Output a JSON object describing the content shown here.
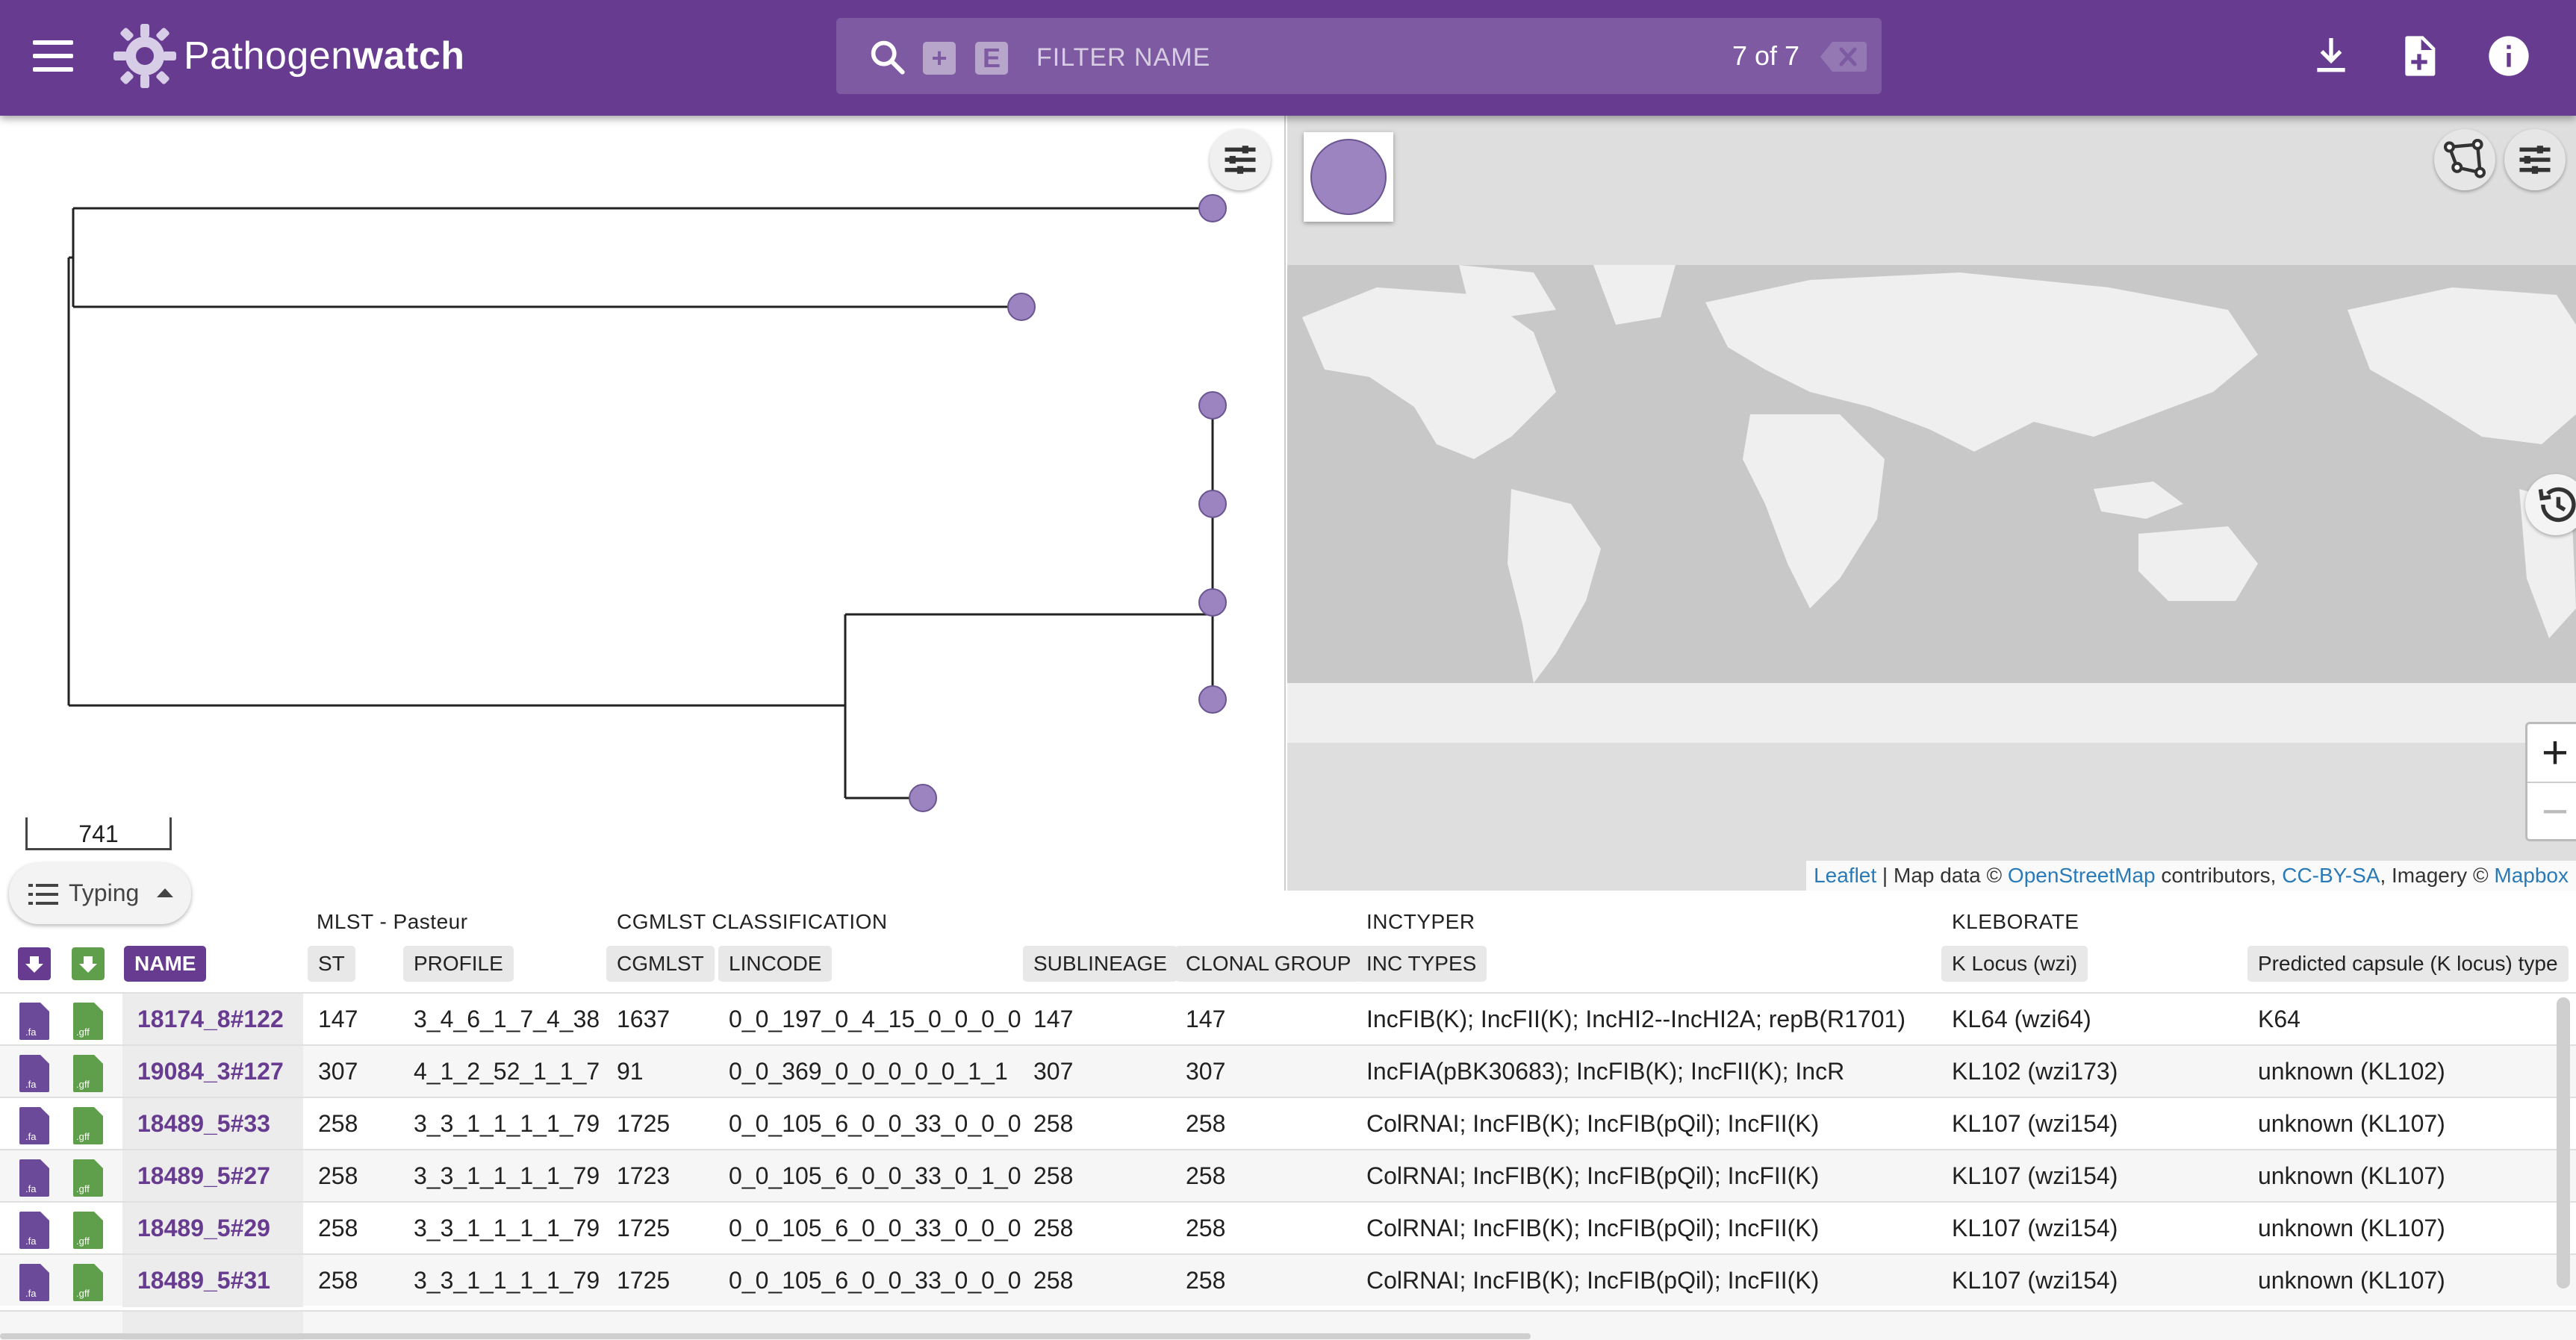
{
  "app": {
    "brand_light": "Pathogen",
    "brand_bold": "watch"
  },
  "search": {
    "placeholder": "FILTER NAME",
    "count": "7 of 7",
    "plus_label": "+",
    "e_label": "E"
  },
  "tree": {
    "scale_label": "741"
  },
  "typing": {
    "label": "Typing"
  },
  "map": {
    "attr_leaflet": "Leaflet",
    "attr_sep": " | Map data © ",
    "attr_osm": "OpenStreetMap",
    "attr_contrib": " contributors, ",
    "attr_cc": "CC-BY-SA",
    "attr_imagery": ", Imagery © ",
    "attr_mapbox": "Mapbox",
    "zoom_in": "+",
    "zoom_out": "−"
  },
  "table": {
    "groups": {
      "mlst": "MLST - Pasteur",
      "cgmlst": "CGMLST CLASSIFICATION",
      "inctyper": "INCTYPER",
      "kleborate": "KLEBORATE"
    },
    "headers": {
      "name": "NAME",
      "st": "ST",
      "profile": "PROFILE",
      "cgmlst": "CGMLST",
      "lincode": "LINCODE",
      "sublineage": "SUBLINEAGE",
      "clonal_group": "CLONAL GROUP",
      "inc_types": "INC TYPES",
      "k_locus": "K Locus (wzi)",
      "capsule": "Predicted capsule (K locus) type"
    },
    "rows": [
      {
        "name": "18174_8#122",
        "st": "147",
        "profile": "3_4_6_1_7_4_38",
        "cgmlst": "1637",
        "lincode": "0_0_197_0_4_15_0_0_0_0",
        "sublineage": "147",
        "clonal_group": "147",
        "inc_types": "IncFIB(K); IncFII(K); IncHI2--IncHI2A; repB(R1701)",
        "k_locus": "KL64 (wzi64)",
        "capsule": "K64"
      },
      {
        "name": "19084_3#127",
        "st": "307",
        "profile": "4_1_2_52_1_1_7",
        "cgmlst": "91",
        "lincode": "0_0_369_0_0_0_0_0_1_1",
        "sublineage": "307",
        "clonal_group": "307",
        "inc_types": "IncFIA(pBK30683); IncFIB(K); IncFII(K); IncR",
        "k_locus": "KL102 (wzi173)",
        "capsule": "unknown (KL102)"
      },
      {
        "name": "18489_5#33",
        "st": "258",
        "profile": "3_3_1_1_1_1_79",
        "cgmlst": "1725",
        "lincode": "0_0_105_6_0_0_33_0_0_0",
        "sublineage": "258",
        "clonal_group": "258",
        "inc_types": "ColRNAI; IncFIB(K); IncFIB(pQil); IncFII(K)",
        "k_locus": "KL107 (wzi154)",
        "capsule": "unknown (KL107)"
      },
      {
        "name": "18489_5#27",
        "st": "258",
        "profile": "3_3_1_1_1_1_79",
        "cgmlst": "1723",
        "lincode": "0_0_105_6_0_0_33_0_1_0",
        "sublineage": "258",
        "clonal_group": "258",
        "inc_types": "ColRNAI; IncFIB(K); IncFIB(pQil); IncFII(K)",
        "k_locus": "KL107 (wzi154)",
        "capsule": "unknown (KL107)"
      },
      {
        "name": "18489_5#29",
        "st": "258",
        "profile": "3_3_1_1_1_1_79",
        "cgmlst": "1725",
        "lincode": "0_0_105_6_0_0_33_0_0_0",
        "sublineage": "258",
        "clonal_group": "258",
        "inc_types": "ColRNAI; IncFIB(K); IncFIB(pQil); IncFII(K)",
        "k_locus": "KL107 (wzi154)",
        "capsule": "unknown (KL107)"
      },
      {
        "name": "18489_5#31",
        "st": "258",
        "profile": "3_3_1_1_1_1_79",
        "cgmlst": "1725",
        "lincode": "0_0_105_6_0_0_33_0_0_0",
        "sublineage": "258",
        "clonal_group": "258",
        "inc_types": "ColRNAI; IncFIB(K); IncFIB(pQil); IncFII(K)",
        "k_locus": "KL107 (wzi154)",
        "capsule": "unknown (KL107)"
      }
    ]
  },
  "files": {
    "fa": ".fa",
    "gff": ".gff"
  },
  "colors": {
    "brand": "#673c90",
    "node": "#9b84bf",
    "file_icon": "#6b4a99",
    "file_icon_gff": "#5f9e4a"
  }
}
